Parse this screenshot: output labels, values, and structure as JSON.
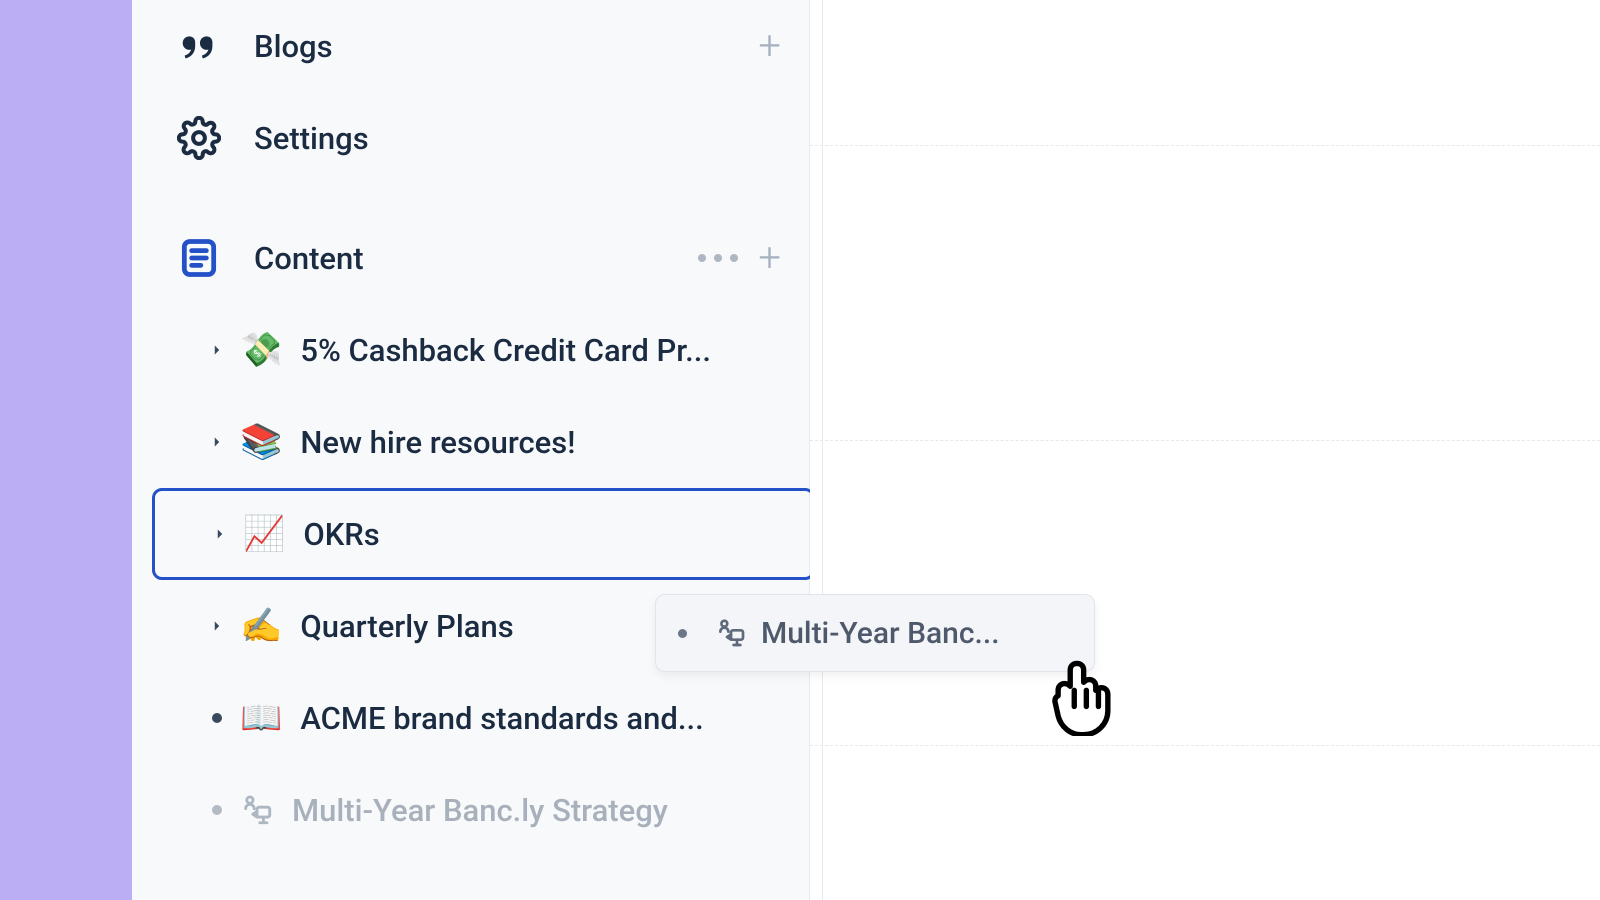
{
  "sidebar": {
    "top": [
      {
        "label": "Blogs",
        "has_plus": true,
        "has_more": false
      },
      {
        "label": "Settings",
        "has_plus": false,
        "has_more": false
      }
    ],
    "section": {
      "label": "Content",
      "has_plus": true,
      "has_more": true,
      "items": [
        {
          "emoji": "💸",
          "label": "5% Cashback Credit Card Pr...",
          "type": "caret",
          "faded": false
        },
        {
          "emoji": "📚",
          "label": "New hire resources!",
          "type": "caret",
          "faded": false
        },
        {
          "emoji": "📈",
          "label": "OKRs",
          "type": "caret",
          "faded": false,
          "selected": true
        },
        {
          "emoji": "✍️",
          "label": "Quarterly Plans",
          "type": "caret",
          "faded": false
        },
        {
          "emoji": "📖",
          "label": "ACME brand standards and...",
          "type": "bullet",
          "faded": false
        },
        {
          "emoji": "",
          "label": "Multi-Year Banc.ly Strategy",
          "type": "bullet",
          "faded": true,
          "placeholder_icon": true
        }
      ]
    }
  },
  "drag_ghost": {
    "label": "Multi-Year Banc..."
  }
}
